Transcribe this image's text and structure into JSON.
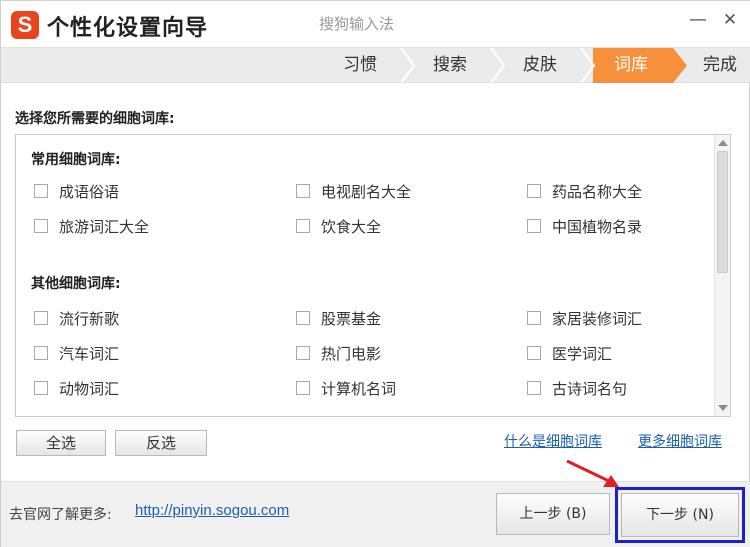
{
  "window": {
    "logo_letter": "S",
    "title": "个性化设置向导",
    "subtitle": "搜狗输入法",
    "minimize_glyph": "—",
    "close_glyph": "✕"
  },
  "steps": [
    {
      "label": "习惯",
      "active": false
    },
    {
      "label": "搜索",
      "active": false
    },
    {
      "label": "皮肤",
      "active": false
    },
    {
      "label": "词库",
      "active": true
    },
    {
      "label": "完成",
      "active": false
    }
  ],
  "accent_color": "#f7903a",
  "main": {
    "section_title": "选择您所需要的细胞词库:",
    "common_group_title": "常用细胞词库:",
    "common_items": [
      "成语俗语",
      "电视剧名大全",
      "药品名称大全",
      "旅游词汇大全",
      "饮食大全",
      "中国植物名录"
    ],
    "other_group_title": "其他细胞词库:",
    "other_items": [
      "流行新歌",
      "股票基金",
      "家居装修词汇",
      "汽车词汇",
      "热门电影",
      "医学词汇",
      "动物词汇",
      "计算机名词",
      "古诗词名句"
    ]
  },
  "buttons": {
    "select_all": "全选",
    "invert_select": "反选",
    "prev": "上一步 (B)",
    "next": "下一步 (N)"
  },
  "links": {
    "what_is": "什么是细胞词库",
    "more": "更多细胞词库"
  },
  "footer": {
    "label": "去官网了解更多:",
    "url": "http://pinyin.sogou.com"
  },
  "annotation": {
    "highlight_color": "#1c21c9",
    "arrow_color": "#e02020"
  }
}
